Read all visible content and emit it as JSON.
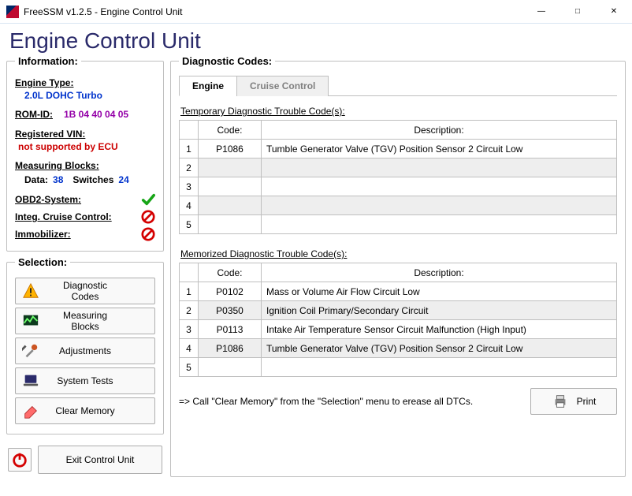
{
  "window": {
    "title": "FreeSSM v1.2.5 - Engine Control Unit"
  },
  "page_title": "Engine Control Unit",
  "information_legend": "Information:",
  "selection_legend": "Selection:",
  "diagnostic_legend": "Diagnostic Codes:",
  "info": {
    "engine_type_label": "Engine Type:",
    "engine_type_value": "2.0L DOHC Turbo",
    "rom_id_label": "ROM-ID:",
    "rom_id_value": "1B 04 40 04 05",
    "vin_label": "Registered VIN:",
    "vin_value": "not supported by ECU",
    "mb_label": "Measuring Blocks:",
    "mb_data_label": "Data:",
    "mb_data_value": "38",
    "mb_sw_label": "Switches",
    "mb_sw_value": "24",
    "obd2_label": "OBD2-System:",
    "icc_label": "Integ. Cruise Control:",
    "immo_label": "Immobilizer:"
  },
  "selection": {
    "diag": "Diagnostic Codes",
    "mb": "Measuring Blocks",
    "adj": "Adjustments",
    "st": "System Tests",
    "cm": "Clear Memory"
  },
  "exit_label": "Exit Control Unit",
  "tabs": {
    "engine": "Engine",
    "cruise": "Cruise Control"
  },
  "temp_caption": "Temporary Diagnostic Trouble Code(s):",
  "mem_caption": "Memorized Diagnostic Trouble Code(s):",
  "col_code": "Code:",
  "col_desc": "Description:",
  "temp_rows": [
    {
      "n": "1",
      "code": "P1086",
      "desc": "Tumble Generator Valve (TGV) Position Sensor 2 Circuit Low"
    },
    {
      "n": "2",
      "code": "",
      "desc": ""
    },
    {
      "n": "3",
      "code": "",
      "desc": ""
    },
    {
      "n": "4",
      "code": "",
      "desc": ""
    },
    {
      "n": "5",
      "code": "",
      "desc": ""
    }
  ],
  "mem_rows": [
    {
      "n": "1",
      "code": "P0102",
      "desc": "Mass or Volume Air Flow Circuit Low"
    },
    {
      "n": "2",
      "code": "P0350",
      "desc": "Ignition Coil Primary/Secondary Circuit"
    },
    {
      "n": "3",
      "code": "P0113",
      "desc": "Intake Air Temperature Sensor Circuit Malfunction (High Input)"
    },
    {
      "n": "4",
      "code": "P1086",
      "desc": "Tumble Generator Valve (TGV) Position Sensor 2 Circuit Low"
    },
    {
      "n": "5",
      "code": "",
      "desc": ""
    }
  ],
  "hint": "=> Call \"Clear Memory\" from the \"Selection\" menu to erease all DTCs.",
  "print_label": "Print"
}
